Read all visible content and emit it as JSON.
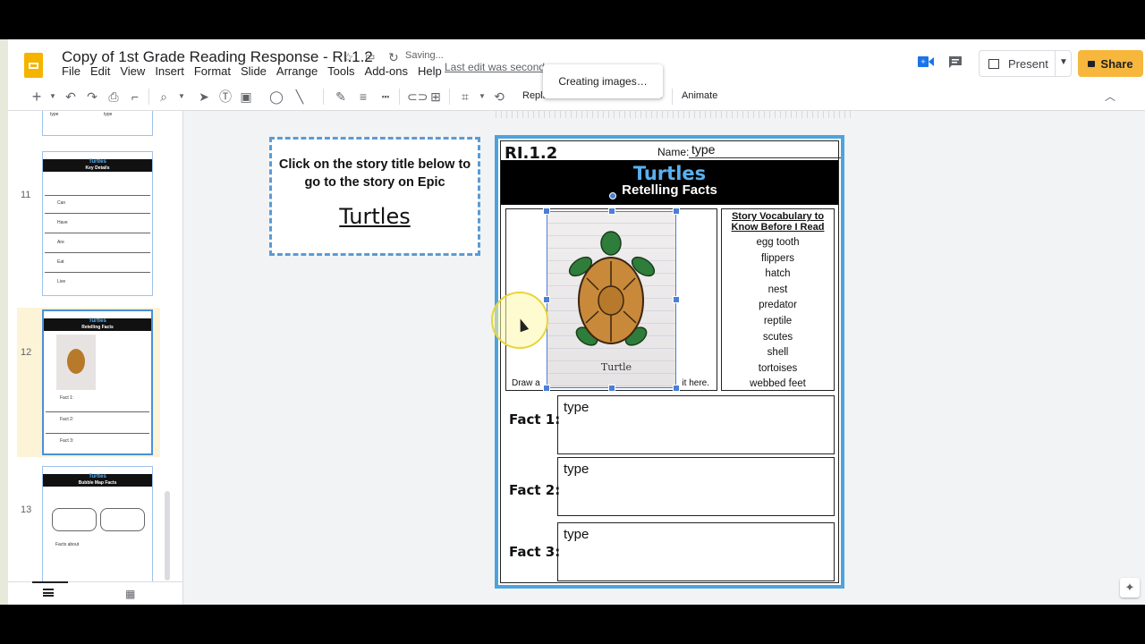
{
  "header": {
    "title": "Copy of 1st Grade Reading Response - RI.1.2",
    "saving": "Saving...",
    "last_edit": "Last edit was second",
    "present_label": "Present",
    "share_label": "Share"
  },
  "menu": [
    "File",
    "Edit",
    "View",
    "Insert",
    "Format",
    "Slide",
    "Arrange",
    "Tools",
    "Add-ons",
    "Help"
  ],
  "toast": "Creating images…",
  "toolbar": {
    "replace_label": "Repla",
    "options_fragment": "s",
    "animate_label": "Animate"
  },
  "filmstrip": {
    "slides": [
      {
        "number": "11",
        "title": "Turtles",
        "subtitle": "Key Details",
        "row_labels": [
          "Can",
          "Have",
          "Are",
          "Eat",
          "Live"
        ],
        "placeholder": "type"
      },
      {
        "number": "12",
        "title": "Turtles",
        "subtitle": "Retelling Facts",
        "row_labels": [
          "Fact 1:",
          "Fact 2:",
          "Fact 3:"
        ],
        "placeholder": "type"
      },
      {
        "number": "13",
        "title": "Turtles",
        "subtitle": "Bubble Map Facts",
        "row_labels": [
          "Facts about"
        ],
        "placeholder": "type"
      }
    ]
  },
  "callout": {
    "instruction": "Click on the story title below to go to the story on Epic",
    "link": "Turtles"
  },
  "slide": {
    "standard": "RI.1.2",
    "name_label": "Name:",
    "name_value": "type",
    "title": "Turtles",
    "subtitle": "Retelling Facts",
    "draw_caption_left": "Draw a",
    "draw_caption_right": "it here.",
    "vocab_heading": "Story Vocabulary to Know Before I Read",
    "vocab": [
      "egg tooth",
      "flippers",
      "hatch",
      "nest",
      "predator",
      "reptile",
      "scutes",
      "shell",
      "tortoises",
      "webbed feet"
    ],
    "facts": [
      {
        "label": "Fact 1:",
        "value": "type"
      },
      {
        "label": "Fact 2:",
        "value": "type"
      },
      {
        "label": "Fact 3:",
        "value": "type"
      }
    ],
    "photo_caption": "Turtle"
  }
}
